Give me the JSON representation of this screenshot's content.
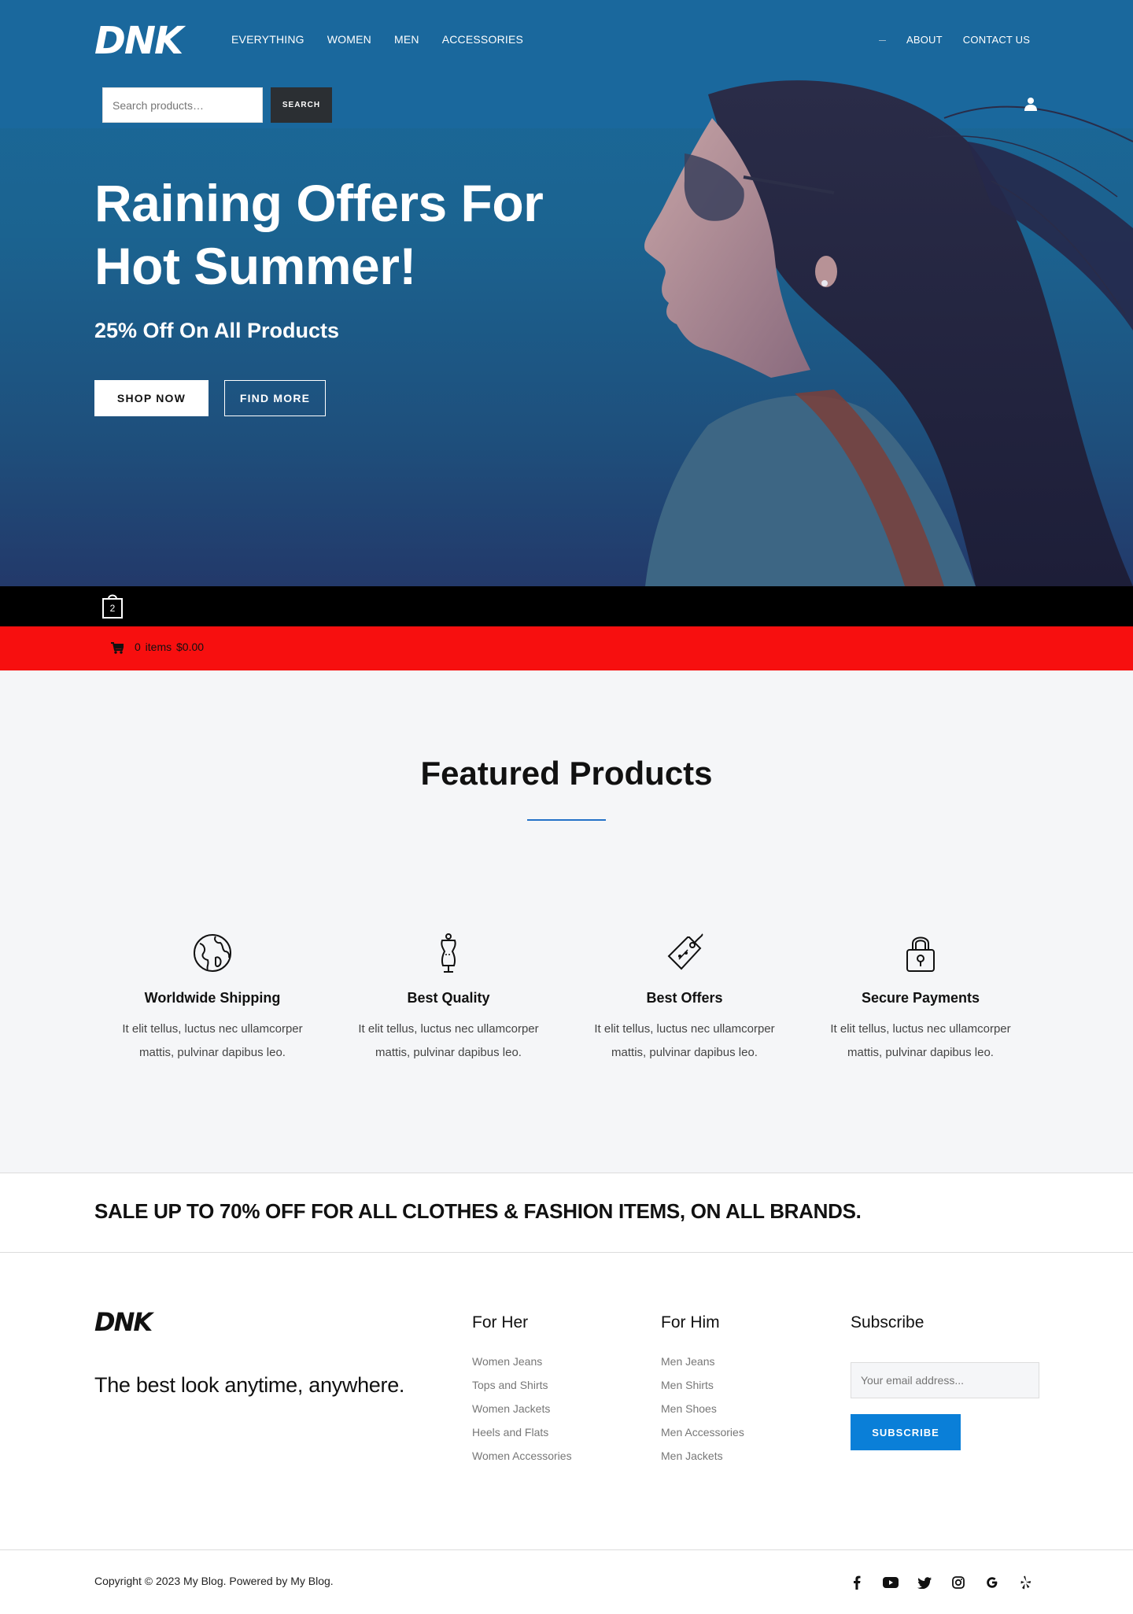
{
  "header": {
    "logo_text": "DNK",
    "nav": [
      "EVERYTHING",
      "WOMEN",
      "MEN",
      "ACCESSORIES"
    ],
    "nav_right": [
      "ABOUT",
      "CONTACT US"
    ],
    "search_placeholder": "Search products…",
    "search_button": "SEARCH"
  },
  "hero": {
    "title": "Raining Offers For Hot Summer!",
    "subtitle": "25% Off On All Products",
    "shop_button": "SHOP NOW",
    "find_button": "FIND MORE"
  },
  "cart": {
    "bag_count": "2",
    "summary": "0 items  $0.00"
  },
  "featured": {
    "title": "Featured Products",
    "items": [
      {
        "icon": "globe-icon",
        "title": "Worldwide Shipping",
        "text": "It elit tellus, luctus nec ullamcorper mattis, pulvinar dapibus leo."
      },
      {
        "icon": "mannequin-icon",
        "title": "Best Quality",
        "text": "It elit tellus, luctus nec ullamcorper mattis, pulvinar dapibus leo."
      },
      {
        "icon": "price-tag-icon",
        "title": "Best Offers",
        "text": "It elit tellus, luctus nec ullamcorper mattis, pulvinar dapibus leo."
      },
      {
        "icon": "padlock-icon",
        "title": "Secure Payments",
        "text": "It elit tellus, luctus nec ullamcorper mattis, pulvinar dapibus leo."
      }
    ]
  },
  "sale": {
    "text": "SALE UP TO 70% OFF FOR ALL CLOTHES & FASHION ITEMS, ON ALL BRANDS."
  },
  "footer": {
    "logo_text": "DNK",
    "tagline": "The best look anytime, anywhere.",
    "for_her": {
      "title": "For Her",
      "links": [
        "Women Jeans",
        "Tops and Shirts",
        "Women Jackets",
        "Heels and Flats",
        "Women Accessories"
      ]
    },
    "for_him": {
      "title": "For Him",
      "links": [
        "Men Jeans",
        "Men Shirts",
        "Men Shoes",
        "Men Accessories",
        "Men Jackets"
      ]
    },
    "subscribe": {
      "title": "Subscribe",
      "placeholder": "Your email address...",
      "button": "SUBSCRIBE"
    },
    "copyright": "Copyright © 2023 My Blog. Powered by My Blog.",
    "social": [
      "facebook-icon",
      "youtube-icon",
      "twitter-icon",
      "instagram-icon",
      "google-icon",
      "yelp-icon"
    ]
  },
  "colors": {
    "hero_blue": "#1a689d",
    "cart_red": "#f70f0f",
    "accent_blue": "#0a7fd8",
    "underline_blue": "#2472c8"
  }
}
